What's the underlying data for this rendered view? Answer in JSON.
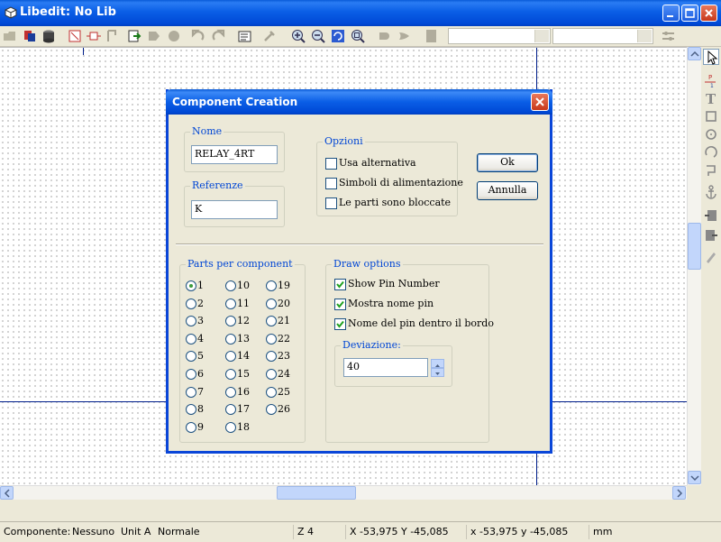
{
  "window": {
    "title": "Libedit: No Lib"
  },
  "dialog": {
    "title": "Component Creation",
    "nome": {
      "label": "Nome",
      "value": "RELAY_4RT"
    },
    "referenze": {
      "label": "Referenze",
      "value": "K"
    },
    "opzioni": {
      "label": "Opzioni",
      "items": [
        {
          "label": "Usa alternativa",
          "checked": false
        },
        {
          "label": "Simboli di alimentazione",
          "checked": false
        },
        {
          "label": "Le parti sono bloccate",
          "checked": false
        }
      ]
    },
    "ok_label": "Ok",
    "cancel_label": "Annulla",
    "parts": {
      "label": "Parts per component",
      "selected": "1",
      "options": [
        "1",
        "2",
        "3",
        "4",
        "5",
        "6",
        "7",
        "8",
        "9",
        "10",
        "11",
        "12",
        "13",
        "14",
        "15",
        "16",
        "17",
        "18",
        "19",
        "20",
        "21",
        "22",
        "23",
        "24",
        "25",
        "26"
      ]
    },
    "draw": {
      "label": "Draw options",
      "items": [
        {
          "label": "Show Pin Number",
          "checked": true
        },
        {
          "label": "Mostra nome pin",
          "checked": true
        },
        {
          "label": "Nome del pin dentro il bordo",
          "checked": true
        }
      ],
      "deviazione": {
        "label": "Deviazione:",
        "value": "40"
      }
    }
  },
  "status": {
    "componente": "Componente:",
    "nessuno": "Nessuno",
    "unit": "Unit A",
    "normale": "Normale",
    "zoom": "Z 4",
    "abs": "X -53,975  Y -45,085",
    "rel": "x -53,975  y -45,085",
    "units": "mm"
  }
}
